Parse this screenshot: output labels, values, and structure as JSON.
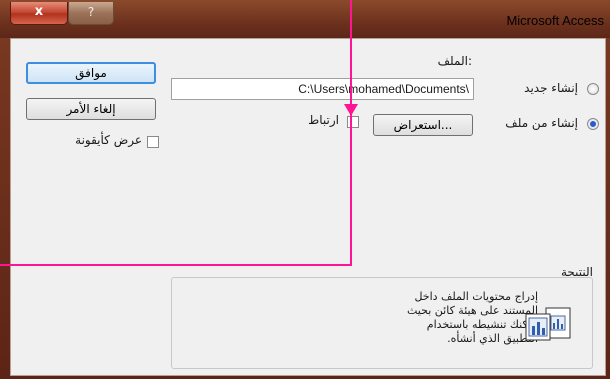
{
  "window": {
    "title": "Microsoft Access",
    "close_label": "x",
    "help_label": "?"
  },
  "buttons": {
    "ok": "موافق",
    "cancel": "إلغاء الأمر",
    "browse": "استعراض..."
  },
  "display_as_icon_label": "عرض كأيقونة",
  "file": {
    "label": "الملف:",
    "path": "C:\\Users\\mohamed\\Documents\\"
  },
  "link_label": "ارتباط",
  "options": [
    {
      "label": "إنشاء جديد",
      "selected": false
    },
    {
      "label": "إنشاء من ملف",
      "selected": true
    }
  ],
  "result": {
    "label": "النتيجة",
    "lines": [
      "إدراج محتويات الملف داخل",
      "المستند على هيئة كائن بحيث",
      "يمكنك تنشيطه باستخدام",
      "التطبيق الذي أنشأه."
    ],
    "icon": "object-icon"
  },
  "annotation_color": "#ff1493"
}
